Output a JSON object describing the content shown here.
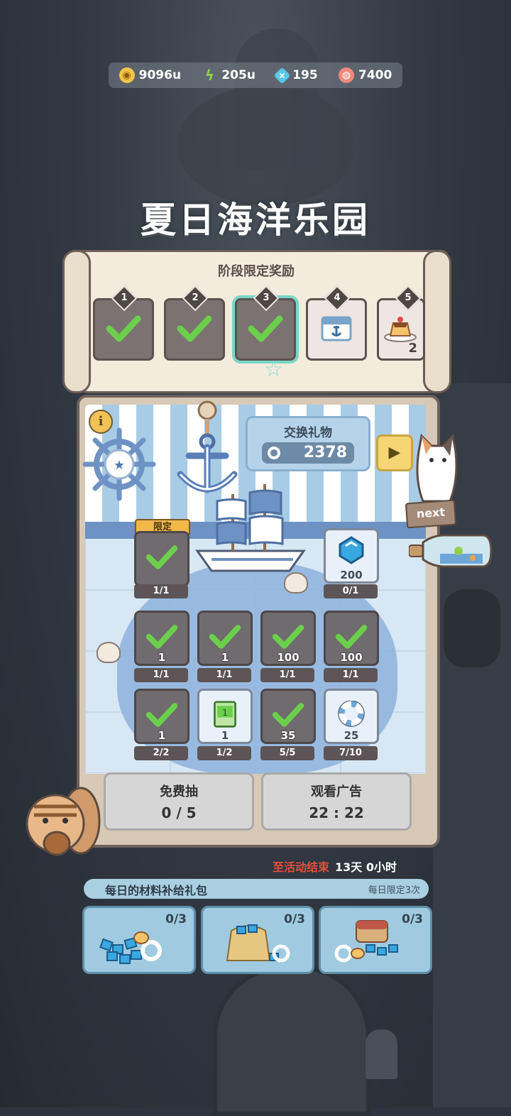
{
  "resources": [
    {
      "icon": "gold-coin-icon",
      "value": "9096u",
      "color": "#f4c545"
    },
    {
      "icon": "lightning-icon",
      "value": "205u",
      "color": "#8fd14f"
    },
    {
      "icon": "gem-icon",
      "value": "195",
      "color": "#58c6e8"
    },
    {
      "icon": "shell-icon",
      "value": "7400",
      "color": "#f08a7c"
    }
  ],
  "title": "夏日海洋乐园",
  "stage_rewards": {
    "title": "阶段限定奖励",
    "stages": [
      {
        "num": "1",
        "claimed": true
      },
      {
        "num": "2",
        "claimed": true
      },
      {
        "num": "3",
        "claimed": true,
        "active": true
      },
      {
        "num": "4",
        "claimed": false,
        "icon": "anchor-flag-icon"
      },
      {
        "num": "5",
        "claimed": false,
        "icon": "pudding-icon",
        "qty": "2"
      }
    ]
  },
  "exchange": {
    "label": "交换礼物",
    "value": "2378"
  },
  "info_label": "i",
  "next_label": "next",
  "limited_label": "限定",
  "items": [
    {
      "amount": "",
      "count": "1/1",
      "claimed": true
    },
    {
      "amount": "200",
      "count": "0/1",
      "claimed": false,
      "icon": "gem-icon"
    },
    {
      "amount": "1",
      "count": "1/1",
      "claimed": true
    },
    {
      "amount": "1",
      "count": "1/1",
      "claimed": true
    },
    {
      "amount": "100",
      "count": "1/1",
      "claimed": true
    },
    {
      "amount": "100",
      "count": "1/1",
      "claimed": true
    },
    {
      "amount": "1",
      "count": "2/2",
      "claimed": true
    },
    {
      "amount": "1",
      "count": "1/2",
      "claimed": false,
      "icon": "ticket-icon"
    },
    {
      "amount": "35",
      "count": "5/5",
      "claimed": true
    },
    {
      "amount": "25",
      "count": "7/10",
      "claimed": false,
      "icon": "lifebuoy-icon"
    }
  ],
  "buttons": {
    "free_draw": {
      "label": "免费抽",
      "value": "0 / 5"
    },
    "watch_ad": {
      "label": "观看广告",
      "value": "22 : 22"
    }
  },
  "event_end": {
    "label": "至活动结束",
    "value": "13天 0小时"
  },
  "daily": {
    "title": "每日的材料补给礼包",
    "limit": "每日限定3次"
  },
  "packs": [
    {
      "count": "0/3",
      "icon": "gem-pile-icon"
    },
    {
      "count": "0/3",
      "icon": "gem-sack-icon"
    },
    {
      "count": "0/3",
      "icon": "treasure-chest-icon"
    }
  ],
  "colors": {
    "check": "#6ccf4c",
    "accent_teal": "#7ad6c8",
    "alert_red": "#e84e3c"
  }
}
